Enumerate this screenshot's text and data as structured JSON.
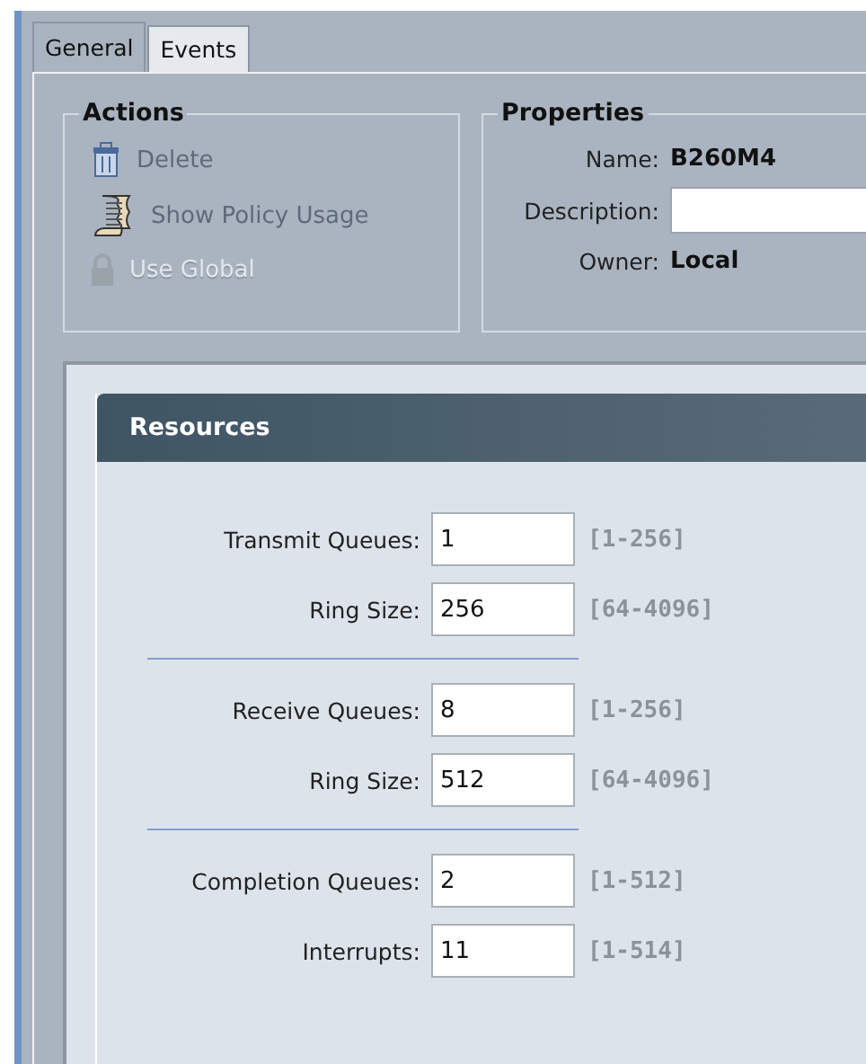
{
  "tabs": [
    {
      "label": "General",
      "selected": true
    },
    {
      "label": "Events",
      "selected": false
    }
  ],
  "actions": {
    "title": "Actions",
    "items": [
      {
        "kind": "delete",
        "label": "Delete",
        "disabled": false
      },
      {
        "kind": "policy",
        "label": "Show Policy Usage",
        "disabled": false
      },
      {
        "kind": "lock",
        "label": "Use Global",
        "disabled": true
      }
    ]
  },
  "properties": {
    "title": "Properties",
    "name_label": "Name:",
    "name": "B260M4",
    "description_label": "Description:",
    "owner_label": "Owner:",
    "owner": "Local"
  },
  "resources": {
    "title": "Resources",
    "groups": [
      [
        {
          "label": "Transmit Queues:",
          "value": "1",
          "range": "[1-256]"
        },
        {
          "label": "Ring Size:",
          "value": "256",
          "range": "[64-4096]"
        }
      ],
      [
        {
          "label": "Receive Queues:",
          "value": "8",
          "range": "[1-256]"
        },
        {
          "label": "Ring Size:",
          "value": "512",
          "range": "[64-4096]"
        }
      ],
      [
        {
          "label": "Completion Queues:",
          "value": "2",
          "range": "[1-512]"
        },
        {
          "label": "Interrupts:",
          "value": "11",
          "range": "[1-514]"
        }
      ]
    ]
  }
}
